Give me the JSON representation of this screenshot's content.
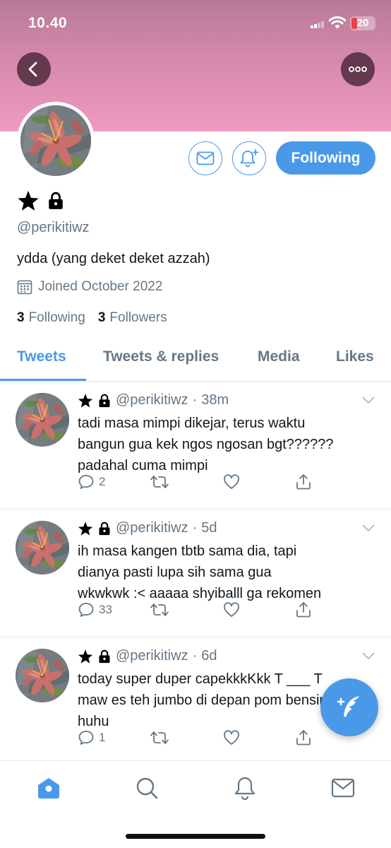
{
  "status_bar": {
    "time": "10.40",
    "battery": "20"
  },
  "profile": {
    "handle": "@perikitiwz",
    "bio": "ydda (yang deket deket azzah)",
    "joined": "Joined October 2022",
    "following_count": "3",
    "following_label": "Following",
    "followers_count": "3",
    "followers_label": "Followers",
    "follow_button": "Following"
  },
  "tabs": [
    {
      "label": "Tweets",
      "active": true
    },
    {
      "label": "Tweets & replies",
      "active": false
    },
    {
      "label": "Media",
      "active": false
    },
    {
      "label": "Likes",
      "active": false
    }
  ],
  "tweets": [
    {
      "handle": "@perikitiwz",
      "time": "38m",
      "lines": [
        "tadi masa mimpi dikejar, terus waktu",
        "bangun gua kek ngos ngosan bgt??????",
        "padahal cuma mimpi"
      ],
      "replies": "2"
    },
    {
      "handle": "@perikitiwz",
      "time": "5d",
      "lines": [
        "ih masa kangen tbtb sama dia, tapi",
        "dianya pasti lupa sih sama gua",
        "wkwkwk :< aaaaa shyiballl ga rekomen"
      ],
      "replies": "33"
    },
    {
      "handle": "@perikitiwz",
      "time": "6d",
      "lines": [
        "today super duper capekkkKkk T ___ T",
        "maw es teh jumbo di depan pom bensin",
        "huhu"
      ],
      "replies": "1"
    }
  ],
  "colors": {
    "accent": "#4a99e9",
    "muted": "#657786",
    "banner": "#f09ac1"
  },
  "icons": [
    "back-arrow-icon",
    "more-dots-icon",
    "mail-icon",
    "bell-plus-icon",
    "star-icon",
    "lock-icon",
    "calendar-icon",
    "reply-icon",
    "retweet-icon",
    "like-icon",
    "share-icon",
    "chevron-down-icon",
    "compose-icon",
    "home-icon",
    "search-icon",
    "notifications-icon",
    "messages-icon"
  ]
}
